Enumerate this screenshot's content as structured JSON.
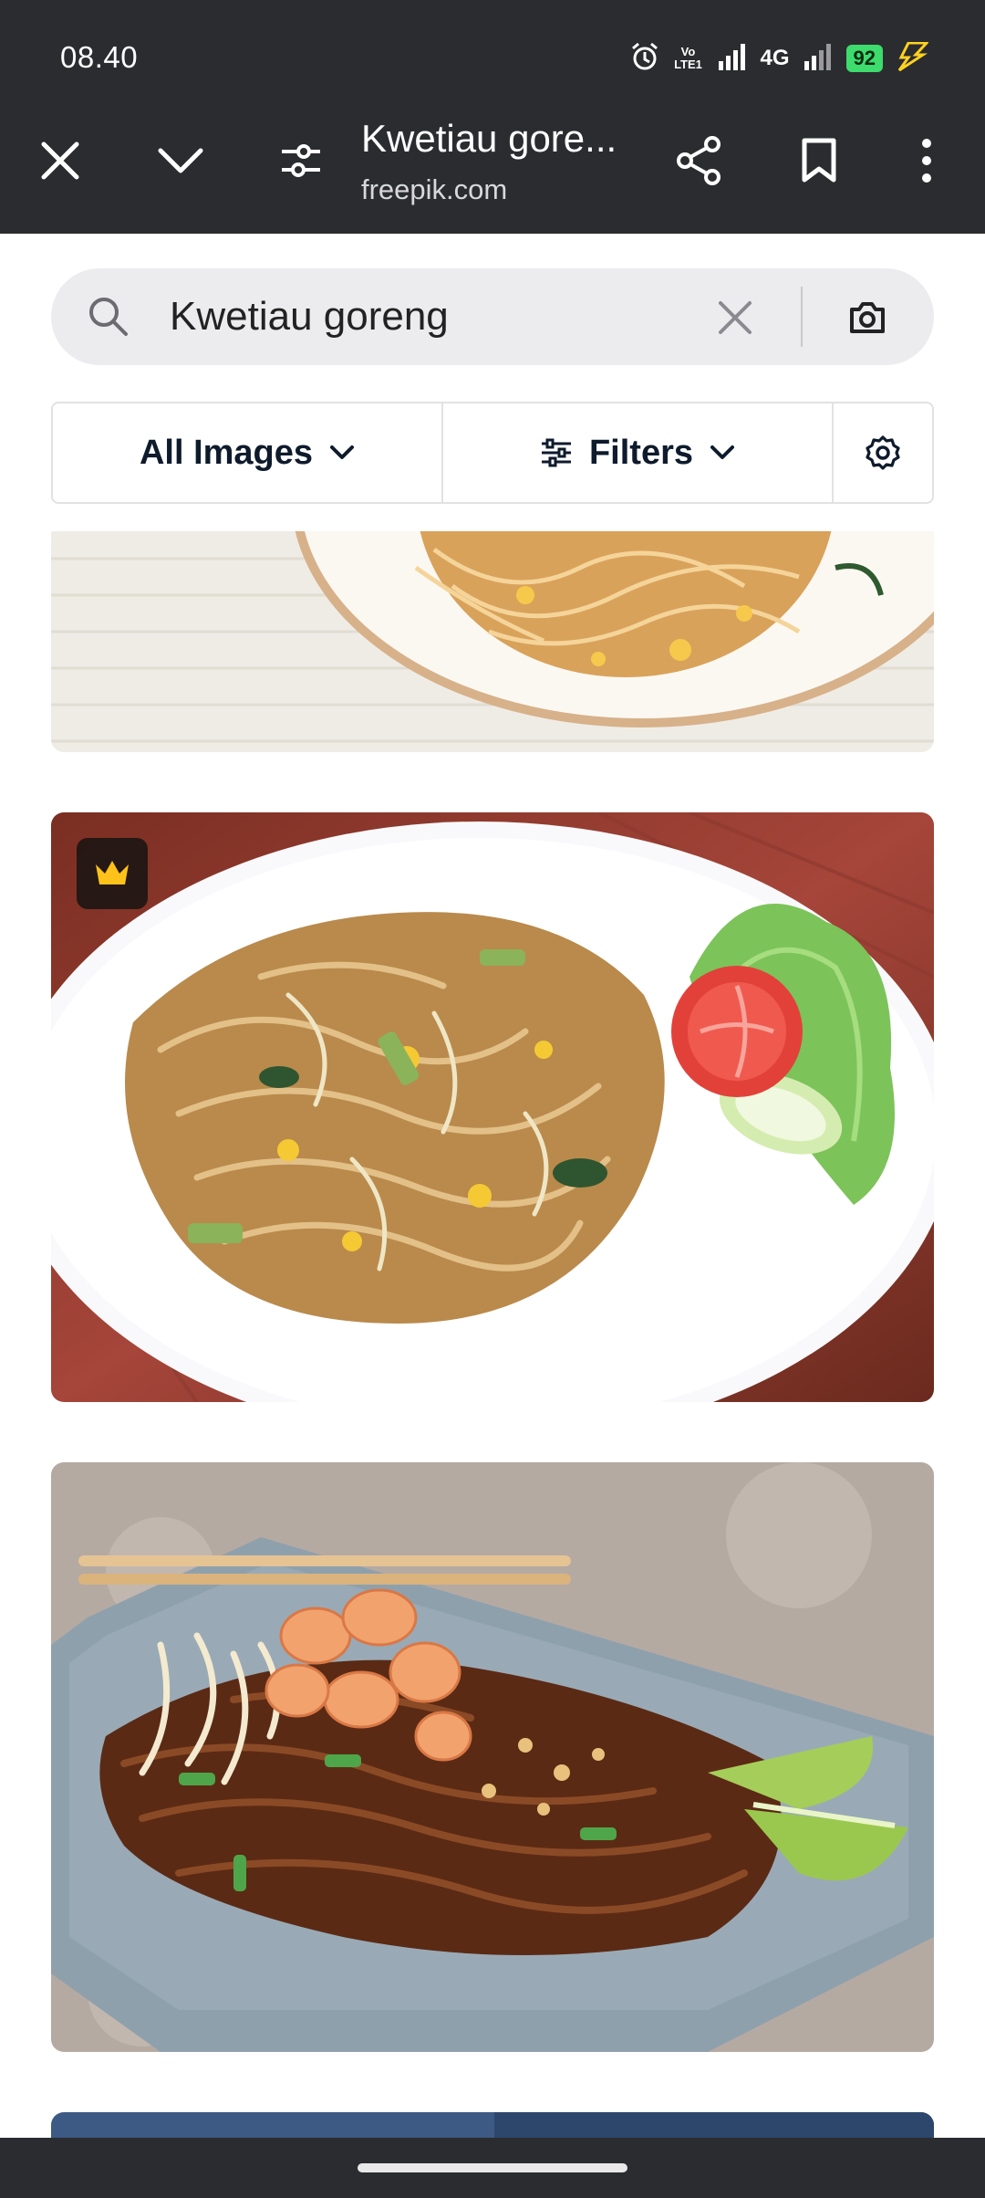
{
  "status_bar": {
    "time": "08.40",
    "network_type": "4G",
    "volte_label": "Vo LTE1",
    "battery_level": "92"
  },
  "toolbar": {
    "page_title": "Kwetiau gore...",
    "domain": "freepik.com",
    "icons": [
      "close-icon",
      "chevron-down-icon",
      "tune-icon",
      "share-icon",
      "bookmark-icon",
      "more-vert-icon"
    ]
  },
  "search": {
    "query": "Kwetiau goreng"
  },
  "filters": {
    "all_images_label": "All Images",
    "filters_label": "Filters"
  },
  "results": [
    {
      "name": "fried-noodles-bowl",
      "premium": false
    },
    {
      "name": "kwetiau-goreng-white-plate",
      "premium": true
    },
    {
      "name": "pad-thai-blue-plate",
      "premium": false
    }
  ],
  "colors": {
    "chrome_bg": "#2b2c30",
    "search_bg": "#ececef",
    "premium_badge": "#ffc21a",
    "battery": "#3ddc6d"
  }
}
